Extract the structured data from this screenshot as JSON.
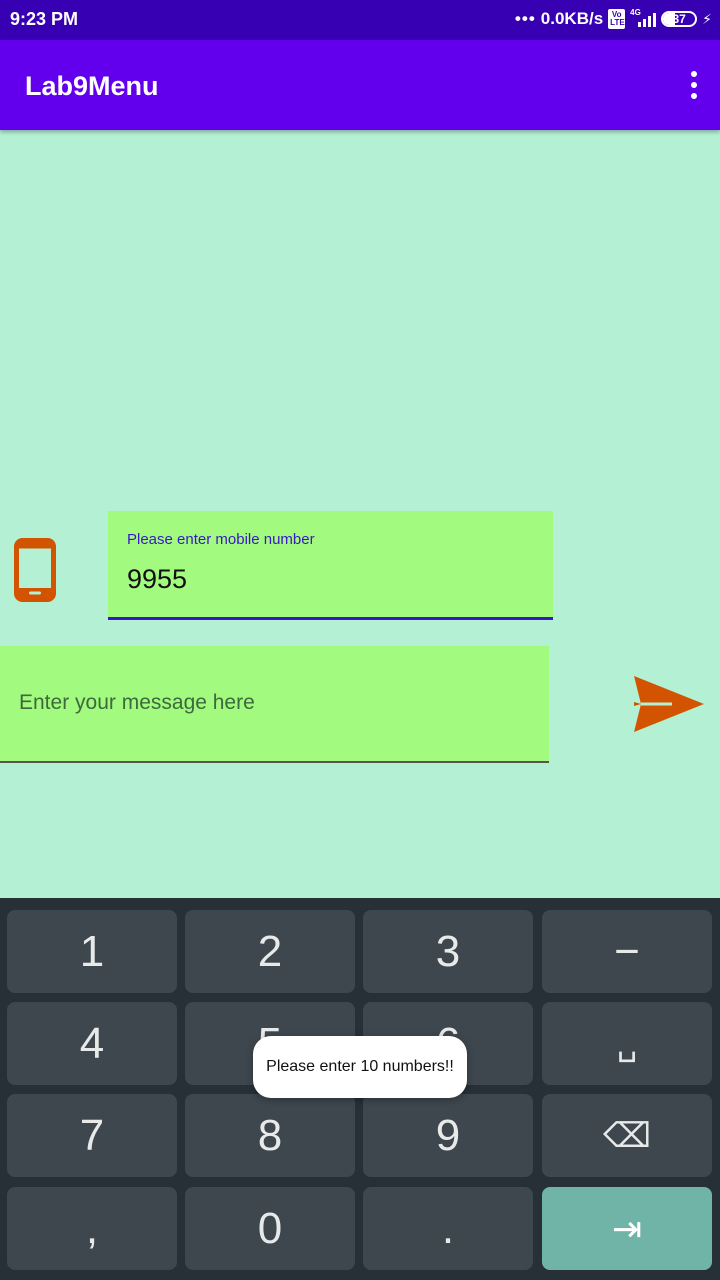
{
  "status_bar": {
    "time": "9:23 PM",
    "network_speed": "0.0KB/s",
    "volte_label": "Vo\nLTE",
    "network_type": "4G",
    "battery_level": "37"
  },
  "app_bar": {
    "title": "Lab9Menu",
    "overflow_icon": "more-vert-icon"
  },
  "form": {
    "phone_icon": "smartphone-icon",
    "mobile_label": "Please enter mobile number",
    "mobile_value": "9955",
    "message_placeholder": "Enter your message here",
    "send_icon": "send-icon"
  },
  "keyboard": {
    "keys": [
      "1",
      "2",
      "3",
      "−",
      "4",
      "5",
      "6",
      "␣",
      "7",
      "8",
      "9",
      "⌫",
      ",",
      "0",
      ".",
      "⇥"
    ]
  },
  "toast": {
    "message": "Please enter 10 numbers!!"
  },
  "colors": {
    "status_bar": "#3700b3",
    "app_bar": "#6200ee",
    "background": "#b4f0d4",
    "field_background": "#a2fa7e",
    "icon_orange": "#d35400",
    "keyboard_background": "#263036",
    "key_background": "#3e474e",
    "accent_key": "#70b4a8"
  }
}
